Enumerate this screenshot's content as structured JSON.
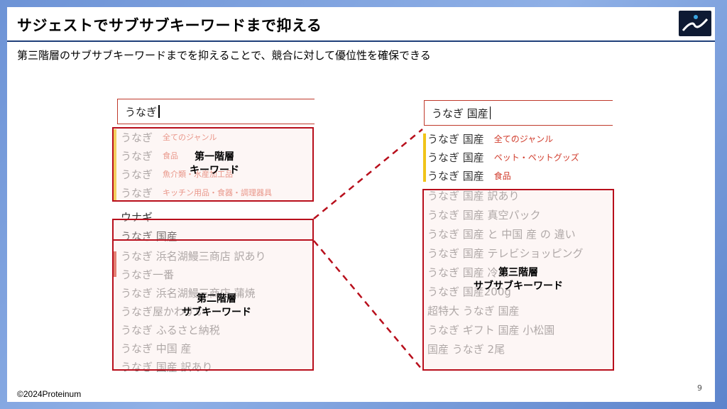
{
  "slide": {
    "title": "サジェストでサブサブキーワードまで抑える",
    "subtitle": "第三階層のサブサブキーワードまでを抑えることで、競合に対して優位性を確保できる",
    "footer": "©2024Proteinum",
    "page_number": "9"
  },
  "left_panel": {
    "query": "うなぎ",
    "first_level_rows": [
      {
        "kw": "うなぎ",
        "cat": "全てのジャンル"
      },
      {
        "kw": "うなぎ",
        "cat": "食品"
      },
      {
        "kw": "うなぎ",
        "cat": "魚介類・水産加工品"
      },
      {
        "kw": "うなぎ",
        "cat": "キッチン用品・食器・調理器具"
      }
    ],
    "plain_row": "ウナギ",
    "selected_row": "うなぎ 国産",
    "second_level_rows": [
      "うなぎ 浜名湖鰻三商店 訳あり",
      "うなぎ一番",
      "うなぎ 浜名湖鰻三商店 蒲焼",
      "うなぎ屋かわすい",
      "うなぎ ふるさと納税",
      "うなぎ 中国 産",
      "うなぎ 国産 訳あり"
    ],
    "label_first": [
      "第一階層",
      "キーワード"
    ],
    "label_second": [
      "第二階層",
      "サブキーワード"
    ]
  },
  "right_panel": {
    "query": "うなぎ 国産",
    "category_rows": [
      {
        "kw": "うなぎ 国産",
        "cat": "全てのジャンル"
      },
      {
        "kw": "うなぎ 国産",
        "cat": "ペット・ペットグッズ"
      },
      {
        "kw": "うなぎ 国産",
        "cat": "食品"
      }
    ],
    "third_level_rows": [
      "うなぎ 国産 訳あり",
      "うなぎ 国産 真空パック",
      "うなぎ 国産 と 中国 産 の 違い",
      "うなぎ 国産 テレビショッピング",
      "うなぎ 国産 冷凍",
      "うなぎ 国産200g",
      "超特大 うなぎ 国産",
      "うなぎ ギフト 国産 小松園",
      "国産 うなぎ 2尾"
    ],
    "label_third": [
      "第三階層",
      "サブサブキーワード"
    ]
  },
  "colors": {
    "frame": "#b80f1c",
    "category_text": "#e06c5a",
    "accent_yellow": "#f0c419",
    "title_rule": "#1f3f7a"
  }
}
